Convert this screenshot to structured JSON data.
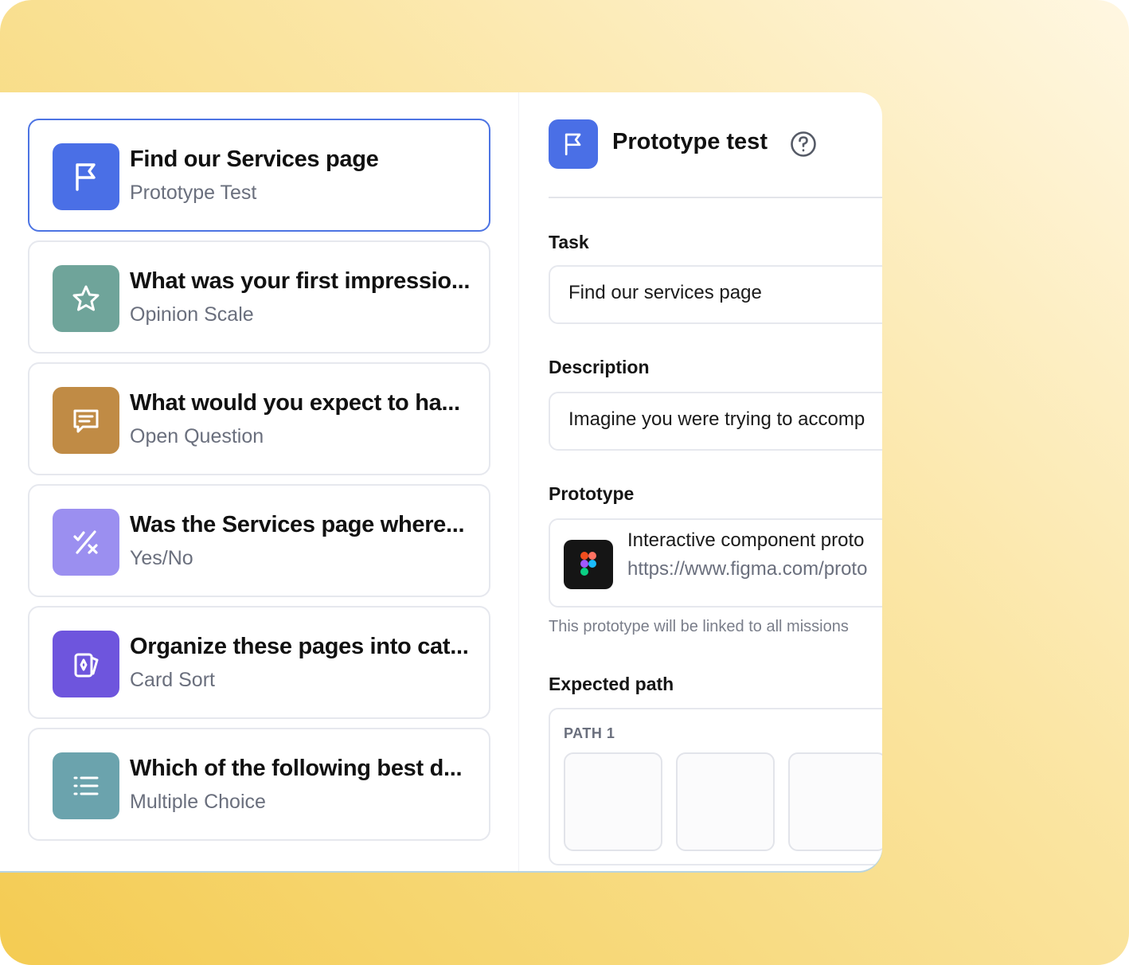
{
  "questions": [
    {
      "title": "Find our Services page",
      "type": "Prototype Test",
      "icon": "flag-icon",
      "color": "#4a6fe6",
      "selected": true
    },
    {
      "title": "What was your first impressio...",
      "type": "Opinion Scale",
      "icon": "star-icon",
      "color": "#6fa49a"
    },
    {
      "title": "What would you expect to ha...",
      "type": "Open Question",
      "icon": "chat-icon",
      "color": "#c08b45"
    },
    {
      "title": "Was the Services page where...",
      "type": "Yes/No",
      "icon": "yes-no-icon",
      "color": "#9b8ff0"
    },
    {
      "title": "Organize these pages into cat...",
      "type": "Card Sort",
      "icon": "card-sort-icon",
      "color": "#6e55dd"
    },
    {
      "title": "Which of the following best d...",
      "type": "Multiple Choice",
      "icon": "list-icon",
      "color": "#6ba3ad"
    }
  ],
  "detail": {
    "title": "Prototype test",
    "task_label": "Task",
    "task_value": "Find our services page",
    "description_label": "Description",
    "description_value": "Imagine you were trying to accomp",
    "prototype_label": "Prototype",
    "prototype_name": "Interactive component proto",
    "prototype_url": "https://www.figma.com/proto",
    "prototype_note": "This prototype will be linked to all missions",
    "expected_path_label": "Expected path",
    "path_label": "PATH 1"
  }
}
